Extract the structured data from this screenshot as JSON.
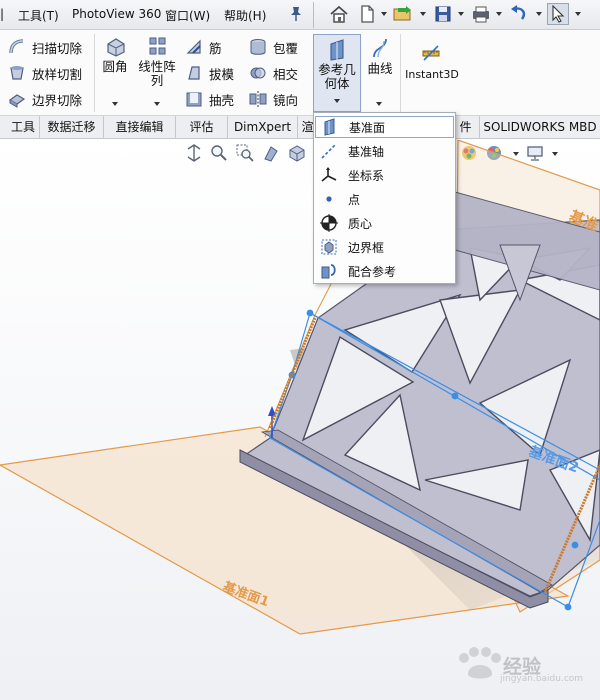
{
  "menubar": {
    "tools_label": "工具(T)",
    "photoview_label": "PhotoView 360",
    "window_label": "窗口(W)",
    "help_label": "帮助(H)"
  },
  "ribbon": {
    "sweep_cut": "扫描切除",
    "loft_cut": "放样切割",
    "boundary_cut": "边界切除",
    "fillet": "圆角",
    "linear_pattern": "线性阵列",
    "rib": "筋",
    "draft": "拔模",
    "shell": "抽壳",
    "wrap": "包覆",
    "intersect": "相交",
    "mirror": "镜向",
    "ref_geometry": "参考几何体",
    "curves": "曲线",
    "instant3d": "Instant3D"
  },
  "tabs": [
    {
      "label": "工具"
    },
    {
      "label": "数据迁移"
    },
    {
      "label": "直接编辑"
    },
    {
      "label": "评估"
    },
    {
      "label": "DimXpert"
    },
    {
      "label": "渲"
    },
    {
      "label": "件"
    },
    {
      "label": "SOLIDWORKS MBD"
    }
  ],
  "dropdown": {
    "items": [
      {
        "label": "基准面",
        "icon": "plane-icon"
      },
      {
        "label": "基准轴",
        "icon": "axis-icon"
      },
      {
        "label": "坐标系",
        "icon": "coordinate-system-icon"
      },
      {
        "label": "点",
        "icon": "point-icon"
      },
      {
        "label": "质心",
        "icon": "center-of-mass-icon"
      },
      {
        "label": "边界框",
        "icon": "bounding-box-icon"
      },
      {
        "label": "配合参考",
        "icon": "mate-reference-icon"
      }
    ]
  },
  "viewport": {
    "plane_label_1": "基准面1",
    "plane_label_back": "基准",
    "plane_label_2": "基准面2"
  },
  "watermark": {
    "text": "经验",
    "sub": "jingyan.baidu.com"
  },
  "colors": {
    "plane_orange": "#e8a04a",
    "selection_blue": "#3a8ee6",
    "part_gray": "#b9b8cc",
    "menu_border": "#a9adb3"
  }
}
